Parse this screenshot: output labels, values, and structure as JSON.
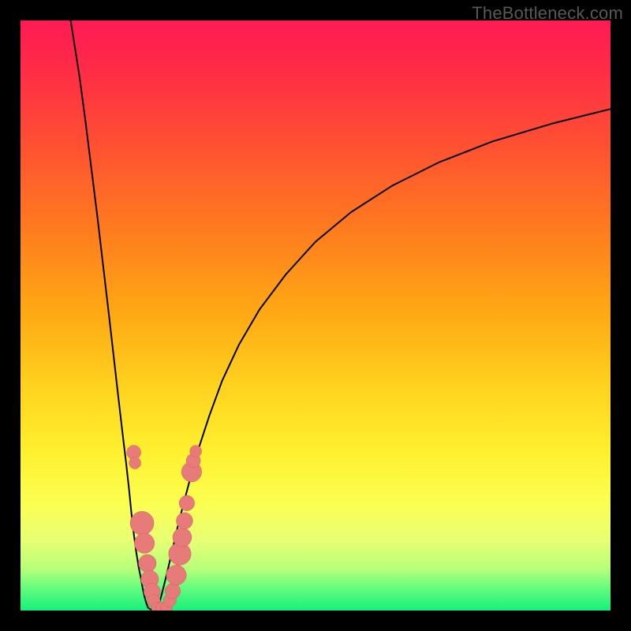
{
  "watermark": "TheBottleneck.com",
  "chart_data": {
    "type": "line",
    "title": "",
    "xlabel": "",
    "ylabel": "",
    "xlim": [
      0,
      100
    ],
    "ylim": [
      0,
      100
    ],
    "grid": false,
    "background_gradient": [
      {
        "offset": 0.0,
        "color": "#ff1a54"
      },
      {
        "offset": 0.08,
        "color": "#ff2b48"
      },
      {
        "offset": 0.2,
        "color": "#ff4d33"
      },
      {
        "offset": 0.35,
        "color": "#ff7a1f"
      },
      {
        "offset": 0.5,
        "color": "#ffaa14"
      },
      {
        "offset": 0.62,
        "color": "#ffd21f"
      },
      {
        "offset": 0.73,
        "color": "#fff02e"
      },
      {
        "offset": 0.82,
        "color": "#fbff52"
      },
      {
        "offset": 0.88,
        "color": "#e8ff73"
      },
      {
        "offset": 0.93,
        "color": "#b7ff7a"
      },
      {
        "offset": 0.965,
        "color": "#5efb7d"
      },
      {
        "offset": 1.0,
        "color": "#17f07c"
      }
    ],
    "series": [
      {
        "name": "left-branch",
        "x": [
          8.5,
          10,
          11,
          12,
          13,
          14,
          15,
          15.8,
          16.6,
          17.3,
          17.9,
          18.4,
          18.8,
          19.2,
          19.6,
          20.0,
          20.4,
          20.7,
          21.0,
          21.3,
          21.6
        ],
        "y": [
          100,
          90.5,
          83.0,
          75.0,
          67.0,
          58.5,
          50.0,
          43.0,
          36.0,
          30.0,
          25.0,
          20.5,
          16.5,
          13.0,
          10.0,
          7.5,
          5.5,
          3.8,
          2.4,
          1.3,
          0.5
        ],
        "stroke": "#000000"
      },
      {
        "name": "right-branch",
        "x": [
          23.2,
          23.6,
          24.0,
          24.5,
          25.1,
          25.8,
          26.6,
          27.6,
          28.8,
          30.2,
          32.0,
          34.2,
          37.0,
          40.5,
          45.0,
          50.0,
          56.0,
          63.0,
          71.0,
          80.0,
          90.0,
          100.0
        ],
        "y": [
          0.5,
          1.5,
          3.0,
          5.0,
          7.5,
          10.5,
          14.0,
          18.0,
          22.5,
          27.5,
          33.0,
          39.0,
          45.0,
          51.0,
          57.0,
          62.5,
          67.5,
          72.0,
          76.0,
          79.5,
          82.5,
          85.0
        ],
        "stroke": "#000000"
      },
      {
        "name": "valley-floor",
        "x": [
          21.6,
          22.0,
          22.4,
          22.8,
          23.2
        ],
        "y": [
          0.5,
          0.2,
          0.15,
          0.2,
          0.5
        ],
        "stroke": "#000000"
      }
    ],
    "markers": [
      {
        "set": "left",
        "x": 19.2,
        "y": 26.8,
        "r": 1.2
      },
      {
        "set": "left",
        "x": 19.4,
        "y": 25.0,
        "r": 1.0
      },
      {
        "set": "left",
        "x": 20.6,
        "y": 14.8,
        "r": 2.0
      },
      {
        "set": "left",
        "x": 21.0,
        "y": 11.4,
        "r": 1.7
      },
      {
        "set": "left",
        "x": 21.5,
        "y": 8.0,
        "r": 1.5
      },
      {
        "set": "left",
        "x": 21.9,
        "y": 5.3,
        "r": 1.5
      },
      {
        "set": "left",
        "x": 22.3,
        "y": 3.2,
        "r": 1.4
      },
      {
        "set": "left",
        "x": 22.6,
        "y": 1.6,
        "r": 1.1
      },
      {
        "set": "floor",
        "x": 23.2,
        "y": 0.45,
        "r": 1.0
      },
      {
        "set": "floor",
        "x": 23.9,
        "y": 0.4,
        "r": 1.0
      },
      {
        "set": "floor",
        "x": 24.7,
        "y": 0.45,
        "r": 1.0
      },
      {
        "set": "right",
        "x": 25.3,
        "y": 1.7,
        "r": 1.1
      },
      {
        "set": "right",
        "x": 25.8,
        "y": 3.3,
        "r": 1.3
      },
      {
        "set": "right",
        "x": 26.4,
        "y": 6.0,
        "r": 1.7
      },
      {
        "set": "right",
        "x": 27.0,
        "y": 9.6,
        "r": 1.9
      },
      {
        "set": "right",
        "x": 27.4,
        "y": 12.4,
        "r": 1.6
      },
      {
        "set": "right",
        "x": 27.8,
        "y": 15.2,
        "r": 1.4
      },
      {
        "set": "right",
        "x": 28.2,
        "y": 18.2,
        "r": 1.3
      },
      {
        "set": "right",
        "x": 29.0,
        "y": 23.5,
        "r": 1.7
      },
      {
        "set": "right",
        "x": 29.3,
        "y": 25.4,
        "r": 1.2
      },
      {
        "set": "right",
        "x": 29.7,
        "y": 27.0,
        "r": 1.0
      }
    ],
    "marker_fill": "#e77b7a",
    "marker_stroke": "#cf5f5e"
  }
}
